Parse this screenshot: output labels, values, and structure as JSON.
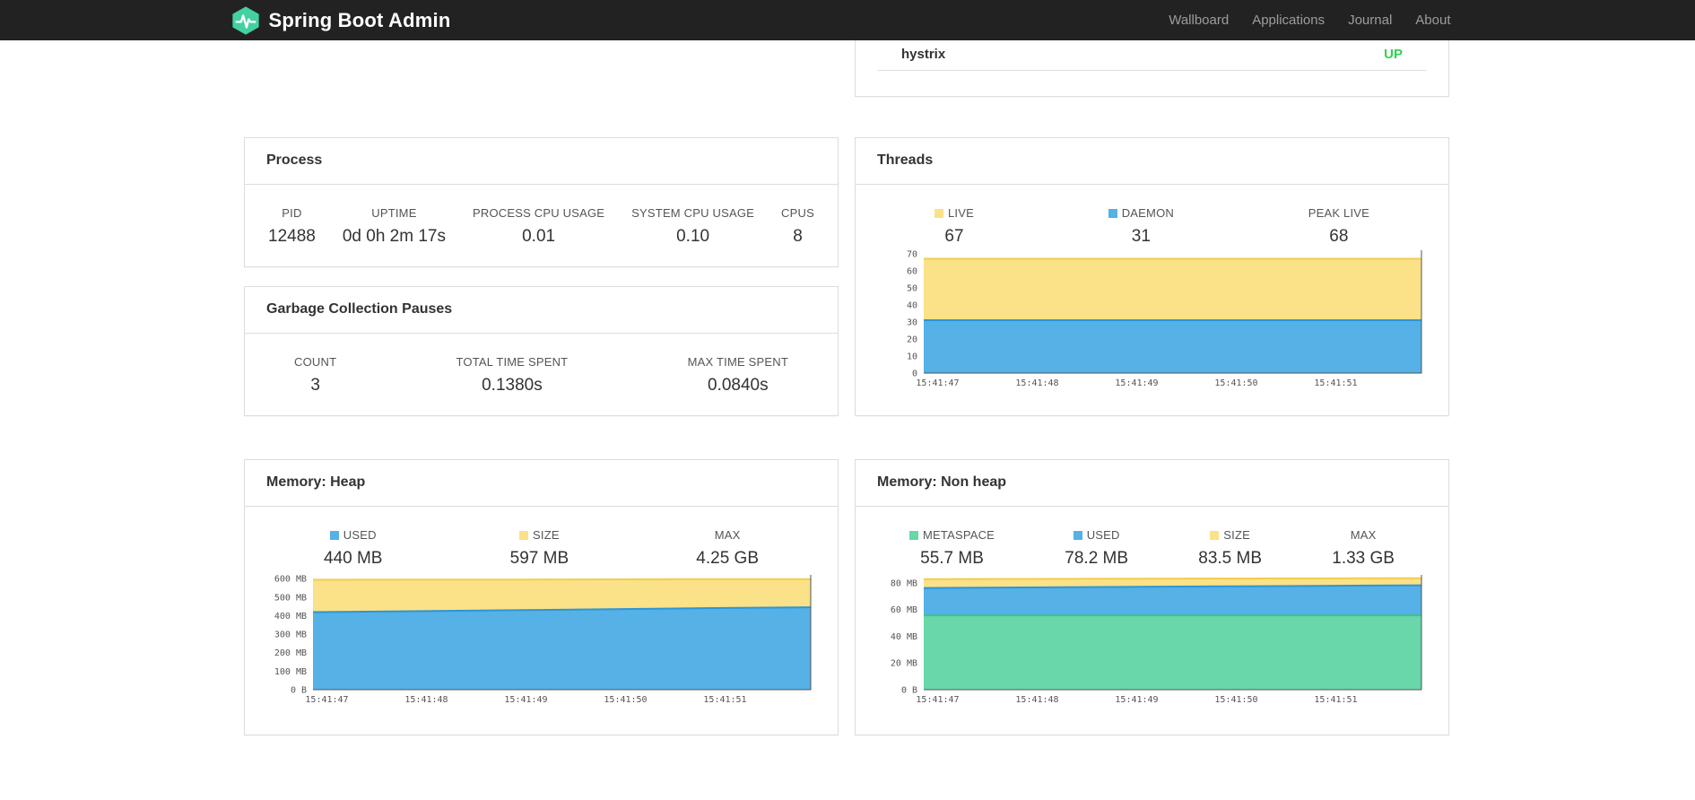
{
  "nav": {
    "brand": "Spring Boot Admin",
    "items": [
      {
        "label": "Wallboard"
      },
      {
        "label": "Applications"
      },
      {
        "label": "Journal"
      },
      {
        "label": "About"
      }
    ]
  },
  "colors": {
    "navbar_bg": "#222222",
    "brand_green": "#43d1a0",
    "blue": "#55b1e6",
    "yellow": "#fbe187",
    "green": "#69d7a9",
    "up": "#2fd24f"
  },
  "application_panel": {
    "rows": [
      {
        "name": "hystrix",
        "status": "UP"
      }
    ]
  },
  "cards": {
    "process": {
      "title": "Process",
      "stats": [
        {
          "label": "PID",
          "value": "12488"
        },
        {
          "label": "UPTIME",
          "value": "0d 0h 2m 17s"
        },
        {
          "label": "PROCESS CPU USAGE",
          "value": "0.01"
        },
        {
          "label": "SYSTEM CPU USAGE",
          "value": "0.10"
        },
        {
          "label": "CPUS",
          "value": "8"
        }
      ]
    },
    "gc": {
      "title": "Garbage Collection Pauses",
      "stats": [
        {
          "label": "COUNT",
          "value": "3"
        },
        {
          "label": "TOTAL TIME SPENT",
          "value": "0.1380s"
        },
        {
          "label": "MAX TIME SPENT",
          "value": "0.0840s"
        }
      ]
    },
    "threads": {
      "title": "Threads",
      "stats": [
        {
          "label": "LIVE",
          "value": "67",
          "swatch": "yellow"
        },
        {
          "label": "DAEMON",
          "value": "31",
          "swatch": "blue"
        },
        {
          "label": "PEAK LIVE",
          "value": "68"
        }
      ]
    },
    "heap": {
      "title": "Memory: Heap",
      "stats": [
        {
          "label": "USED",
          "value": "440 MB",
          "swatch": "blue"
        },
        {
          "label": "SIZE",
          "value": "597 MB",
          "swatch": "yellow"
        },
        {
          "label": "MAX",
          "value": "4.25 GB"
        }
      ]
    },
    "nonheap": {
      "title": "Memory: Non heap",
      "stats": [
        {
          "label": "METASPACE",
          "value": "55.7 MB",
          "swatch": "green"
        },
        {
          "label": "USED",
          "value": "78.2 MB",
          "swatch": "blue"
        },
        {
          "label": "SIZE",
          "value": "83.5 MB",
          "swatch": "yellow"
        },
        {
          "label": "MAX",
          "value": "1.33 GB"
        }
      ]
    }
  },
  "chart_data": [
    {
      "id": "threads",
      "type": "area",
      "title": "Threads",
      "stacked": false,
      "x_ticks": [
        "15:41:47",
        "15:41:48",
        "15:41:49",
        "15:41:50",
        "15:41:51"
      ],
      "ylim": [
        0,
        72
      ],
      "y_ticks": [
        {
          "v": 0,
          "label": "0"
        },
        {
          "v": 10,
          "label": "10"
        },
        {
          "v": 20,
          "label": "20"
        },
        {
          "v": 30,
          "label": "30"
        },
        {
          "v": 40,
          "label": "40"
        },
        {
          "v": 50,
          "label": "50"
        },
        {
          "v": 60,
          "label": "60"
        },
        {
          "v": 70,
          "label": "70"
        }
      ],
      "series": [
        {
          "name": "LIVE",
          "fill": "#fbe187",
          "line": "#f2cd4e",
          "values": [
            67,
            67,
            67,
            67,
            67,
            67
          ]
        },
        {
          "name": "DAEMON",
          "fill": "#55b1e6",
          "line": "#2d96d6",
          "values": [
            31,
            31,
            31,
            31,
            31,
            31
          ]
        }
      ]
    },
    {
      "id": "heap",
      "type": "area",
      "title": "Memory: Heap",
      "stacked": false,
      "x_ticks": [
        "15:41:47",
        "15:41:48",
        "15:41:49",
        "15:41:50",
        "15:41:51"
      ],
      "ylim": [
        0,
        620
      ],
      "y_ticks": [
        {
          "v": 0,
          "label": "0 B"
        },
        {
          "v": 100,
          "label": "100 MB"
        },
        {
          "v": 200,
          "label": "200 MB"
        },
        {
          "v": 300,
          "label": "300 MB"
        },
        {
          "v": 400,
          "label": "400 MB"
        },
        {
          "v": 500,
          "label": "500 MB"
        },
        {
          "v": 600,
          "label": "600 MB"
        }
      ],
      "series": [
        {
          "name": "SIZE",
          "fill": "#fbe187",
          "line": "#f2cd4e",
          "values": [
            594,
            595,
            595,
            596,
            597,
            597
          ]
        },
        {
          "name": "USED",
          "fill": "#55b1e6",
          "line": "#2d96d6",
          "values": [
            419,
            424,
            429,
            435,
            441,
            445
          ]
        }
      ]
    },
    {
      "id": "nonheap",
      "type": "area",
      "title": "Memory: Non heap",
      "stacked": false,
      "x_ticks": [
        "15:41:47",
        "15:41:48",
        "15:41:49",
        "15:41:50",
        "15:41:51"
      ],
      "ylim": [
        0,
        86
      ],
      "y_ticks": [
        {
          "v": 0,
          "label": "0 B"
        },
        {
          "v": 20,
          "label": "20 MB"
        },
        {
          "v": 40,
          "label": "40 MB"
        },
        {
          "v": 60,
          "label": "60 MB"
        },
        {
          "v": 80,
          "label": "80 MB"
        }
      ],
      "series": [
        {
          "name": "SIZE",
          "fill": "#fbe187",
          "line": "#f2cd4e",
          "values": [
            82.8,
            83.0,
            83.1,
            83.3,
            83.4,
            83.5
          ]
        },
        {
          "name": "USED",
          "fill": "#55b1e6",
          "line": "#2d96d6",
          "values": [
            76.2,
            76.6,
            77.0,
            77.4,
            77.8,
            78.2
          ]
        },
        {
          "name": "METASPACE",
          "fill": "#69d7a9",
          "line": "#3cc488",
          "values": [
            55.7,
            55.7,
            55.7,
            55.7,
            55.7,
            55.7
          ]
        }
      ]
    }
  ]
}
